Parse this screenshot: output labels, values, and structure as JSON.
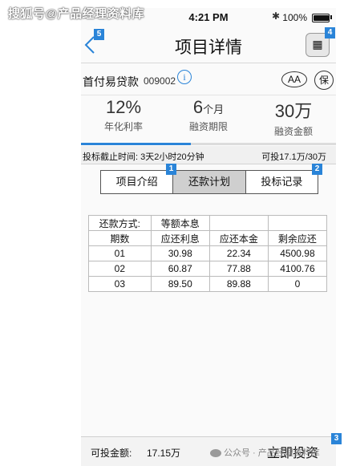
{
  "watermark_top": "搜狐号@产品经理资料库",
  "watermark_bottom": "公众号 · 产品经理资料库",
  "status": {
    "time": "4:21 PM",
    "battery": "100%",
    "battery_level": 1.0,
    "bluetooth_icon": "bluetooth-icon"
  },
  "nav": {
    "title": "项目详情",
    "back_icon": "chevron-left-icon",
    "calc_icon": "calculator-icon",
    "calc_glyph": "▦"
  },
  "badges": {
    "back": "5",
    "calc": "4",
    "intro": "1",
    "records": "2",
    "invest": "3"
  },
  "product": {
    "name": "首付易贷款",
    "code": "009002",
    "info_glyph": "i",
    "aa": "AA",
    "bao": "保"
  },
  "stats": [
    {
      "value": "12%",
      "unit": "",
      "label": "年化利率"
    },
    {
      "value": "6",
      "unit": "个月",
      "label": "融资期限"
    },
    {
      "value": "30万",
      "unit": "",
      "label": "融资金额"
    }
  ],
  "progress": 0.43,
  "deadline": {
    "text": "投标截止时间: 3天2小时20分钟",
    "remain": "可投17.1万/30万"
  },
  "tabs": [
    {
      "label": "项目介绍",
      "active": false
    },
    {
      "label": "还款计划",
      "active": true
    },
    {
      "label": "投标记录",
      "active": false
    }
  ],
  "plan": {
    "method_label": "还款方式:",
    "method_value": "等额本息",
    "headers": [
      "期数",
      "应还利息",
      "应还本金",
      "剩余应还"
    ],
    "rows": [
      [
        "01",
        "30.98",
        "22.34",
        "4500.98"
      ],
      [
        "02",
        "60.87",
        "77.88",
        "4100.76"
      ],
      [
        "03",
        "89.50",
        "89.88",
        "0"
      ]
    ]
  },
  "footer": {
    "label": "可投金额:",
    "value": "17.15万",
    "invest": "立即投资"
  },
  "colors": {
    "accent": "#2a84d8",
    "tab_active": "#cfcfcf"
  }
}
